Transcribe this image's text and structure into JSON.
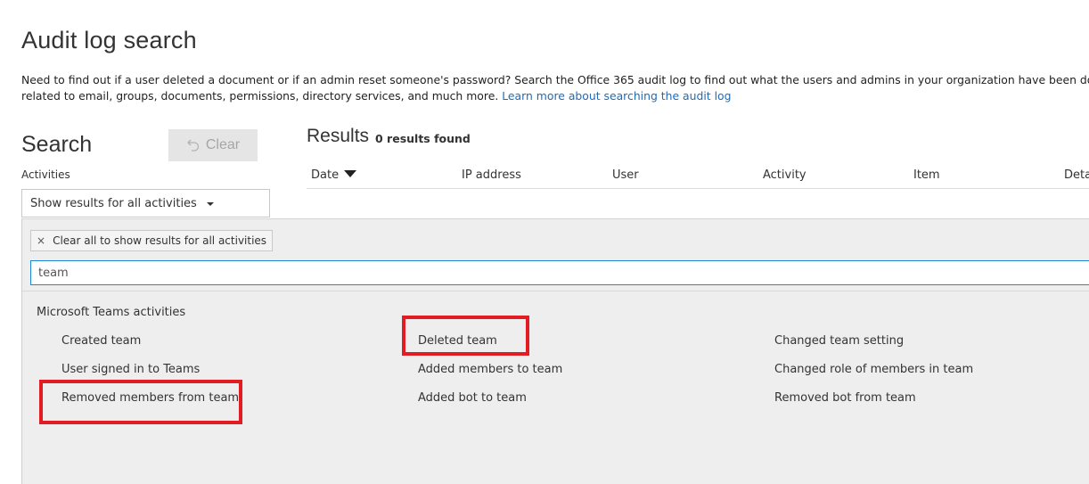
{
  "page": {
    "title": "Audit log search",
    "intro_line1": "Need to find out if a user deleted a document or if an admin reset someone's password? Search the Office 365 audit log to find out what the users and admins in your organization have been doing. You'll",
    "intro_line2": "related to email, groups, documents, permissions, directory services, and much more.",
    "intro_link": "Learn more about searching the audit log"
  },
  "search": {
    "heading": "Search",
    "clear_label": "Clear",
    "activities_label": "Activities",
    "activities_value": "Show results for all activities"
  },
  "results": {
    "heading": "Results",
    "count": "0 results found",
    "columns": [
      "Date",
      "IP address",
      "User",
      "Activity",
      "Item",
      "Deta"
    ]
  },
  "dropdown": {
    "clear_chip_icon": "×",
    "clear_chip_label": "Clear all to show results for all activities",
    "filter_value": "team",
    "group_label": "Microsoft Teams activities",
    "items": [
      "Created team",
      "Deleted team",
      "Changed team setting",
      "User signed in to Teams",
      "Added members to team",
      "Changed role of members in team",
      "Removed members from team",
      "Added bot to team",
      "Removed bot from team"
    ]
  },
  "icons": {
    "clear": "undo-icon",
    "sort": "sort-descending-icon",
    "dropdown": "caret-down-icon"
  },
  "colors": {
    "link": "#1e6bb8",
    "highlight": "#e31b23",
    "input_focus": "#1e88d6",
    "panel_bg": "#eeeeee"
  }
}
